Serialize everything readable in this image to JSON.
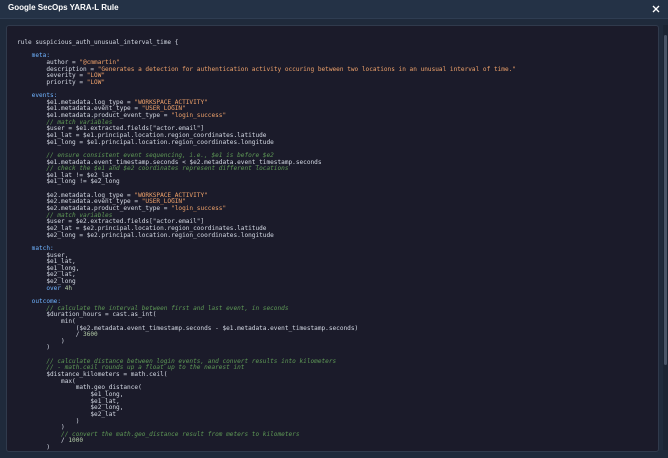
{
  "window": {
    "title": "Google SecOps YARA-L Rule",
    "close_icon": "close-icon"
  },
  "colors": {
    "background": "#1f2a3b",
    "panel": "#1b1b2a",
    "keyword": "#6fb3ff",
    "string": "#f1a36b",
    "comment": "#5f9a56"
  },
  "code_lines": [
    [
      [
        "txt",
        "rule suspicious_auth_unusual_interval_time {"
      ]
    ],
    [
      [
        "txt",
        ""
      ]
    ],
    [
      [
        "key",
        "    meta:"
      ]
    ],
    [
      [
        "txt",
        "        author = "
      ],
      [
        "str",
        "\"@cmmartin\""
      ]
    ],
    [
      [
        "txt",
        "        description = "
      ],
      [
        "str",
        "\"Generates a detection for authentication activity occuring between two locations in an unusual interval of time.\""
      ]
    ],
    [
      [
        "txt",
        "        severity = "
      ],
      [
        "str",
        "\"LOW\""
      ]
    ],
    [
      [
        "txt",
        "        priority = "
      ],
      [
        "str",
        "\"LOW\""
      ]
    ],
    [
      [
        "txt",
        ""
      ]
    ],
    [
      [
        "key",
        "    events:"
      ]
    ],
    [
      [
        "txt",
        "        $e1.metadata.log_type = "
      ],
      [
        "str",
        "\"WORKSPACE_ACTIVITY\""
      ]
    ],
    [
      [
        "txt",
        "        $e1.metadata.event_type = "
      ],
      [
        "str",
        "\"USER_LOGIN\""
      ]
    ],
    [
      [
        "txt",
        "        $e1.metadata.product_event_type = "
      ],
      [
        "str",
        "\"login_success\""
      ]
    ],
    [
      [
        "com",
        "        // match variables"
      ]
    ],
    [
      [
        "txt",
        "        $user = $e1.extracted.fields[\"actor.email\"]"
      ]
    ],
    [
      [
        "txt",
        "        $e1_lat = $e1.principal.location.region_coordinates.latitude"
      ]
    ],
    [
      [
        "txt",
        "        $e1_long = $e1.principal.location.region_coordinates.longitude"
      ]
    ],
    [
      [
        "txt",
        ""
      ]
    ],
    [
      [
        "com",
        "        // ensure consistent event sequencing, i.e., $e1 is before $e2"
      ]
    ],
    [
      [
        "txt",
        "        $e1.metadata.event_timestamp.seconds < $e2.metadata.event_timestamp.seconds"
      ]
    ],
    [
      [
        "com",
        "        // check the $e1 and $e2 coordinates represent different locations"
      ]
    ],
    [
      [
        "txt",
        "        $e1_lat != $e2_lat"
      ]
    ],
    [
      [
        "txt",
        "        $e1_long != $e2_long"
      ]
    ],
    [
      [
        "txt",
        ""
      ]
    ],
    [
      [
        "txt",
        "        $e2.metadata.log_type = "
      ],
      [
        "str",
        "\"WORKSPACE_ACTIVITY\""
      ]
    ],
    [
      [
        "txt",
        "        $e2.metadata.event_type = "
      ],
      [
        "str",
        "\"USER_LOGIN\""
      ]
    ],
    [
      [
        "txt",
        "        $e2.metadata.product_event_type = "
      ],
      [
        "str",
        "\"login_success\""
      ]
    ],
    [
      [
        "com",
        "        // match variables"
      ]
    ],
    [
      [
        "txt",
        "        $user = $e2.extracted.fields[\"actor.email\"]"
      ]
    ],
    [
      [
        "txt",
        "        $e2_lat = $e2.principal.location.region_coordinates.latitude"
      ]
    ],
    [
      [
        "txt",
        "        $e2_long = $e2.principal.location.region_coordinates.longitude"
      ]
    ],
    [
      [
        "txt",
        ""
      ]
    ],
    [
      [
        "key",
        "    match:"
      ]
    ],
    [
      [
        "txt",
        "        $user,"
      ]
    ],
    [
      [
        "txt",
        "        $e1_lat,"
      ]
    ],
    [
      [
        "txt",
        "        $e1_long,"
      ]
    ],
    [
      [
        "txt",
        "        $e2_lat,"
      ]
    ],
    [
      [
        "txt",
        "        $e2_long"
      ]
    ],
    [
      [
        "key",
        "        over "
      ],
      [
        "num",
        "4h"
      ]
    ],
    [
      [
        "txt",
        ""
      ]
    ],
    [
      [
        "key",
        "    outcome:"
      ]
    ],
    [
      [
        "com",
        "        // calculate the interval between first and last event, in seconds"
      ]
    ],
    [
      [
        "txt",
        "        $duration_hours = cast.as_int("
      ]
    ],
    [
      [
        "txt",
        "            min("
      ]
    ],
    [
      [
        "txt",
        "                ($e2.metadata.event_timestamp.seconds - $e1.metadata.event_timestamp.seconds)"
      ]
    ],
    [
      [
        "txt",
        "                / "
      ],
      [
        "num",
        "3600"
      ]
    ],
    [
      [
        "txt",
        "            )"
      ]
    ],
    [
      [
        "txt",
        "        )"
      ]
    ],
    [
      [
        "txt",
        ""
      ]
    ],
    [
      [
        "com",
        "        // calculate distance between login events, and convert results into kilometers"
      ]
    ],
    [
      [
        "com",
        "        // - math.ceil rounds up a float up to the nearest int"
      ]
    ],
    [
      [
        "txt",
        "        $distance_kilometers = math.ceil("
      ]
    ],
    [
      [
        "txt",
        "            max("
      ]
    ],
    [
      [
        "txt",
        "                math.geo_distance("
      ]
    ],
    [
      [
        "txt",
        "                    $e1_long,"
      ]
    ],
    [
      [
        "txt",
        "                    $e1_lat,"
      ]
    ],
    [
      [
        "txt",
        "                    $e2_long,"
      ]
    ],
    [
      [
        "txt",
        "                    $e2_lat"
      ]
    ],
    [
      [
        "txt",
        "                )"
      ]
    ],
    [
      [
        "txt",
        "            )"
      ]
    ],
    [
      [
        "com",
        "            // convert the math.geo_distance result from meters to kilometers"
      ]
    ],
    [
      [
        "txt",
        "            / "
      ],
      [
        "num",
        "1000"
      ]
    ],
    [
      [
        "txt",
        "        )"
      ]
    ]
  ]
}
